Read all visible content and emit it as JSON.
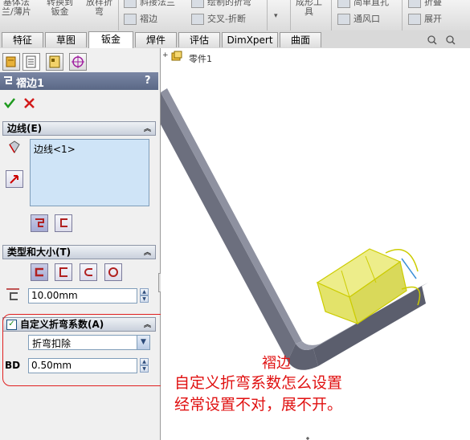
{
  "ribbon": {
    "items": [
      {
        "line1": "基体法",
        "line2": "兰/薄片"
      },
      {
        "line1": "转换到",
        "line2": "钣金"
      },
      {
        "line1": "放样折",
        "line2": "弯"
      },
      {
        "line1": "斜接法兰",
        "line2": "褶边"
      },
      {
        "line1": "绘制的折弯",
        "line2": "交叉-折断"
      },
      {
        "line1": "成形工",
        "line2": "具"
      },
      {
        "line1": "简单直孔",
        "line2": "通风口"
      },
      {
        "line1": "折叠",
        "line2": "展开"
      }
    ]
  },
  "tabs": [
    {
      "label": "特征"
    },
    {
      "label": "草图"
    },
    {
      "label": "钣金"
    },
    {
      "label": "焊件"
    },
    {
      "label": "评估"
    },
    {
      "label": "DimXpert"
    },
    {
      "label": "曲面"
    }
  ],
  "active_tab": "钣金",
  "feature": {
    "title": "褶边1",
    "help": "?"
  },
  "edges_group": {
    "title": "边线(E)",
    "list_items": [
      "边线<1>"
    ]
  },
  "type_size_group": {
    "title": "类型和大小(T)",
    "length_value": "10.00mm"
  },
  "custom_bend_group": {
    "title": "自定义折弯系数(A)",
    "checked": true,
    "type_selected": "折弯扣除",
    "bd_label": "BD",
    "bd_value": "0.50mm"
  },
  "tree": {
    "part_label": "零件1"
  },
  "annotation": {
    "lines": [
      "褶边",
      "自定义折弯系数怎么设置",
      "经常设置不对，展不开。"
    ]
  },
  "colors": {
    "panel_header": "#5a6886",
    "annotation_red": "#e01010",
    "selection_yellow": "#e8e800",
    "part_gray": "#6c6f7e"
  }
}
